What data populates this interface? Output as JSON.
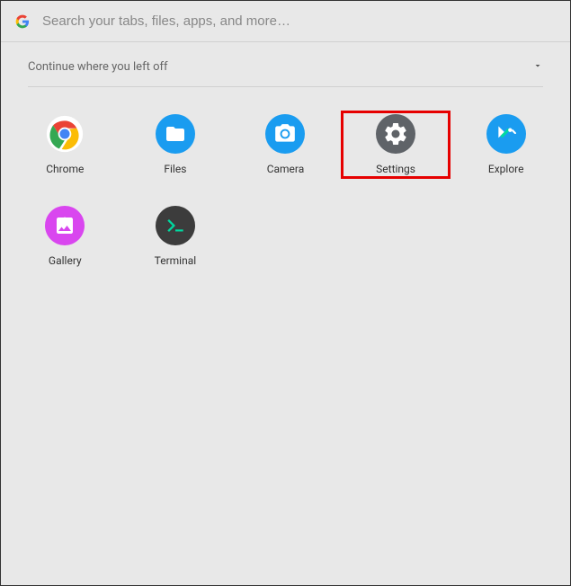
{
  "search": {
    "placeholder": "Search your tabs, files, apps, and more…",
    "value": ""
  },
  "continue_section": {
    "label": "Continue where you left off"
  },
  "apps": [
    {
      "id": "chrome",
      "label": "Chrome",
      "highlighted": false
    },
    {
      "id": "files",
      "label": "Files",
      "highlighted": false
    },
    {
      "id": "camera",
      "label": "Camera",
      "highlighted": false
    },
    {
      "id": "settings",
      "label": "Settings",
      "highlighted": true
    },
    {
      "id": "explore",
      "label": "Explore",
      "highlighted": false
    },
    {
      "id": "gallery",
      "label": "Gallery",
      "highlighted": false
    },
    {
      "id": "terminal",
      "label": "Terminal",
      "highlighted": false
    }
  ],
  "colors": {
    "highlight_border": "#e60000",
    "background": "#e8e8e8"
  }
}
